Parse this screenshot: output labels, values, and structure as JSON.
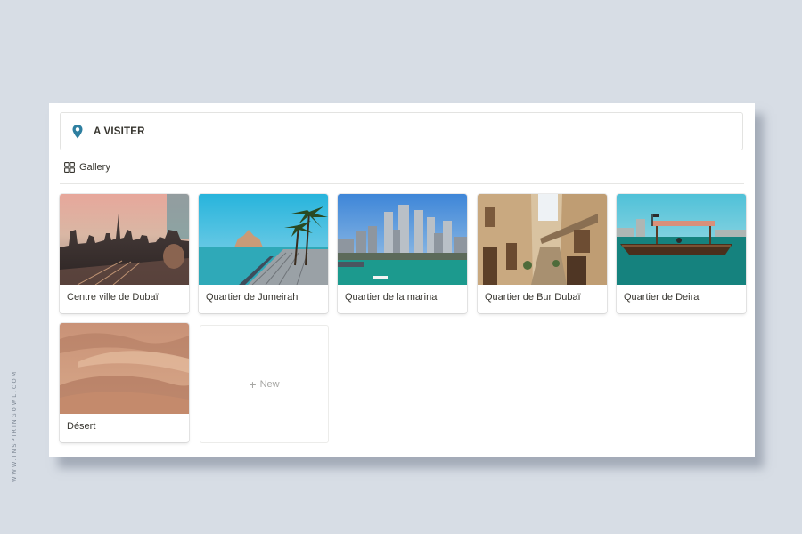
{
  "watermark": "WWW.INSPIRINGOWL.COM",
  "callout": {
    "icon": "map-pin-icon",
    "title": "A VISITER"
  },
  "view": {
    "icon": "gallery-grid-icon",
    "label": "Gallery"
  },
  "cards": [
    {
      "name": "Centre ville de Dubaï"
    },
    {
      "name": "Quartier de Jumeirah"
    },
    {
      "name": "Quartier de la marina"
    },
    {
      "name": "Quartier de Bur Dubaï"
    },
    {
      "name": "Quartier de Deira"
    },
    {
      "name": "Désert"
    }
  ],
  "new_card": {
    "icon": "plus-icon",
    "label": "New"
  },
  "colors": {
    "pin": "#2e7fa0",
    "text": "#37352f",
    "background": "#d7dde5"
  }
}
